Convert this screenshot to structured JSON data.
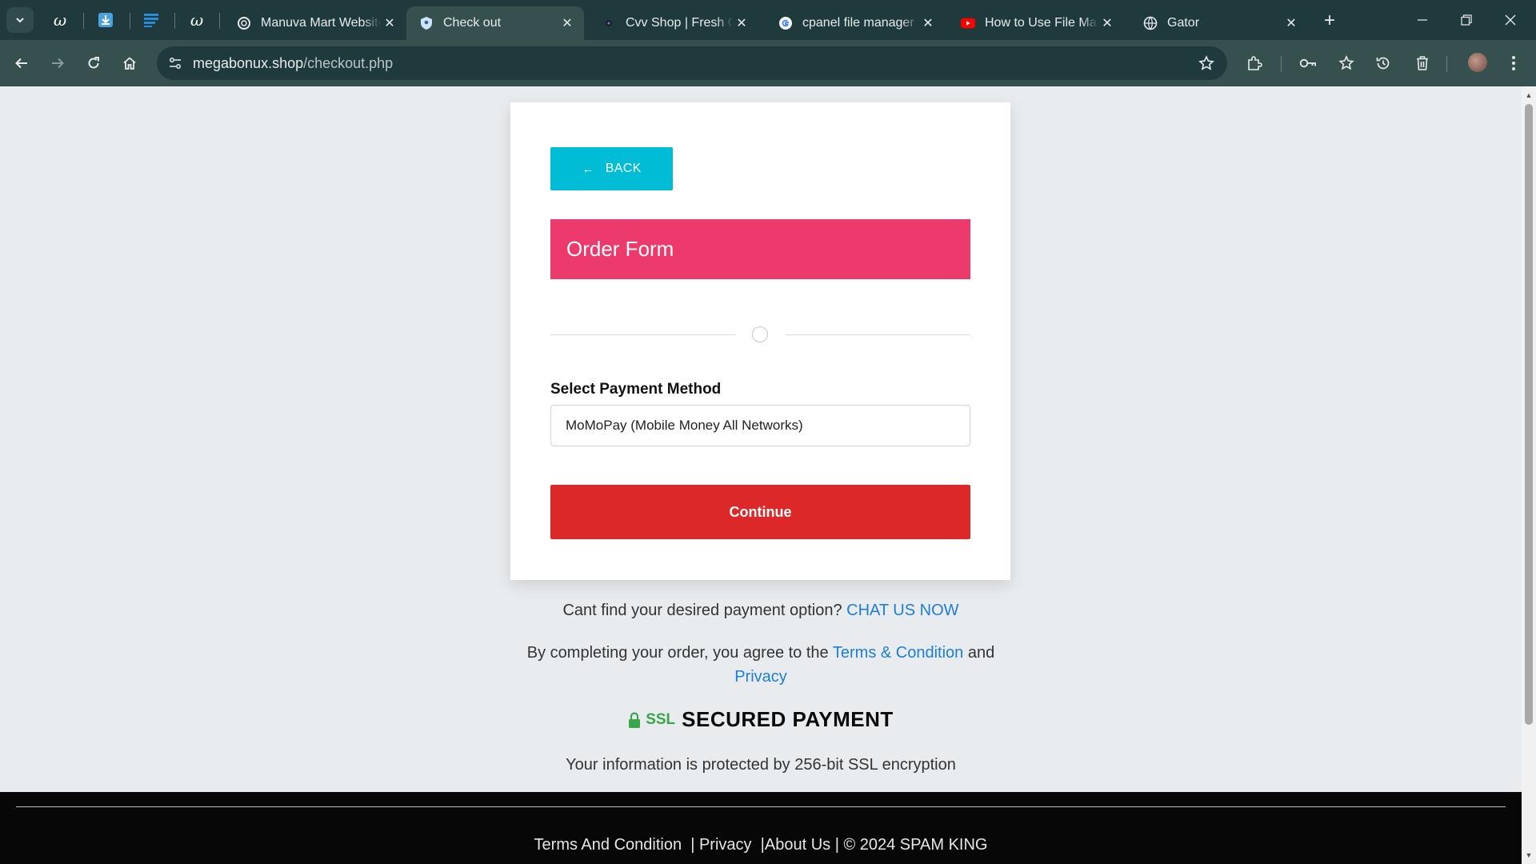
{
  "browser": {
    "tabs": [
      {
        "title": "Manuva Mart Website",
        "favicon": "openai-icon",
        "active": false
      },
      {
        "title": "Check out",
        "favicon": "shield-icon",
        "active": true
      },
      {
        "title": "Cvv Shop | Fresh Cvv",
        "favicon": "dark-dot-icon",
        "active": false
      },
      {
        "title": "cpanel file manager",
        "favicon": "google-icon",
        "active": false
      },
      {
        "title": "How to Use File Manager",
        "favicon": "youtube-icon",
        "active": false
      },
      {
        "title": "Gator",
        "favicon": "globe-icon",
        "active": false
      }
    ],
    "pinned_tabs": [
      "script-w-icon",
      "download-icon",
      "docs-icon",
      "script-w-icon"
    ],
    "url_host": "megabonux.shop",
    "url_path": "/checkout.php",
    "accent": "#35504f"
  },
  "page": {
    "back_label": "BACK",
    "form_title": "Order Form",
    "payment_label": "Select Payment Method",
    "payment_selected": "MoMoPay (Mobile Money All Networks)",
    "continue_label": "Continue",
    "help_text": "Cant find your desired payment option?",
    "help_link": "CHAT US NOW",
    "agree_text": "By completing your order, you agree to the",
    "terms_link": "Terms & Condition",
    "and_text": "and",
    "privacy_link": "Privacy",
    "ssl_label": "SSL",
    "secured_label": "SECURED PAYMENT",
    "protection_text": "Your information is protected by 256-bit SSL encryption",
    "colors": {
      "back_button": "#00bcd4",
      "header": "#ec3a6d",
      "continue_button": "#dc2828",
      "link": "#1e7dd6",
      "ssl": "#3aa64a"
    }
  },
  "footer": {
    "terms": "Terms And Condition",
    "privacy": "Privacy",
    "about": "About Us",
    "copyright": "© 2024 SPAM KING"
  }
}
